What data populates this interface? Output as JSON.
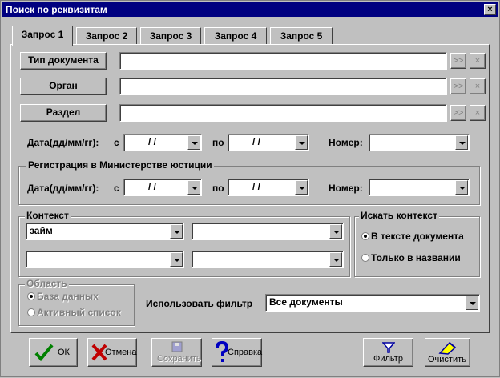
{
  "window": {
    "title": "Поиск по реквизитам"
  },
  "icons": {
    "close": "×",
    "forward": ">>",
    "clear": "×"
  },
  "tabs": [
    {
      "label": "Запрос 1",
      "active": true
    },
    {
      "label": "Запрос 2"
    },
    {
      "label": "Запрос 3"
    },
    {
      "label": "Запрос 4"
    },
    {
      "label": "Запрос 5"
    }
  ],
  "requisites": {
    "doc_type_button": "Тип документа",
    "organ_button": "Орган",
    "section_button": "Раздел",
    "doc_type_value": "",
    "organ_value": "",
    "section_value": ""
  },
  "date_row": {
    "label": "Дата(дд/мм/гг):",
    "from_label": "с",
    "from_value": "/ /",
    "to_label": "по",
    "to_value": "/ /",
    "number_label": "Номер:",
    "number_value": ""
  },
  "registration": {
    "title": "Регистрация в Министерстве юстиции",
    "date_label": "Дата(дд/мм/гг):",
    "from_label": "с",
    "from_value": "/ /",
    "to_label": "по",
    "to_value": "/ /",
    "number_label": "Номер:",
    "number_value": ""
  },
  "context": {
    "title": "Контекст",
    "field1": "займ",
    "field2": "",
    "field3": "",
    "field4": ""
  },
  "search_context": {
    "title": "Искать контекст",
    "options": [
      "В тексте документа",
      "Только в названии"
    ],
    "selected": 0
  },
  "area": {
    "title": "Область",
    "options": [
      "База данных",
      "Активный список"
    ],
    "selected": 0
  },
  "filter": {
    "label": "Использовать фильтр",
    "value": "Все документы"
  },
  "buttons": {
    "ok": "ОК",
    "cancel": "Отмена",
    "save": "Сохранить",
    "help": "Справка",
    "filter": "Фильтр",
    "clear": "Очистить"
  },
  "colors": {
    "titlebar": "#000080",
    "face": "#c0c0c0",
    "ok_check": "#008000",
    "cancel_x": "#c00000",
    "help_q": "#0000c0"
  }
}
